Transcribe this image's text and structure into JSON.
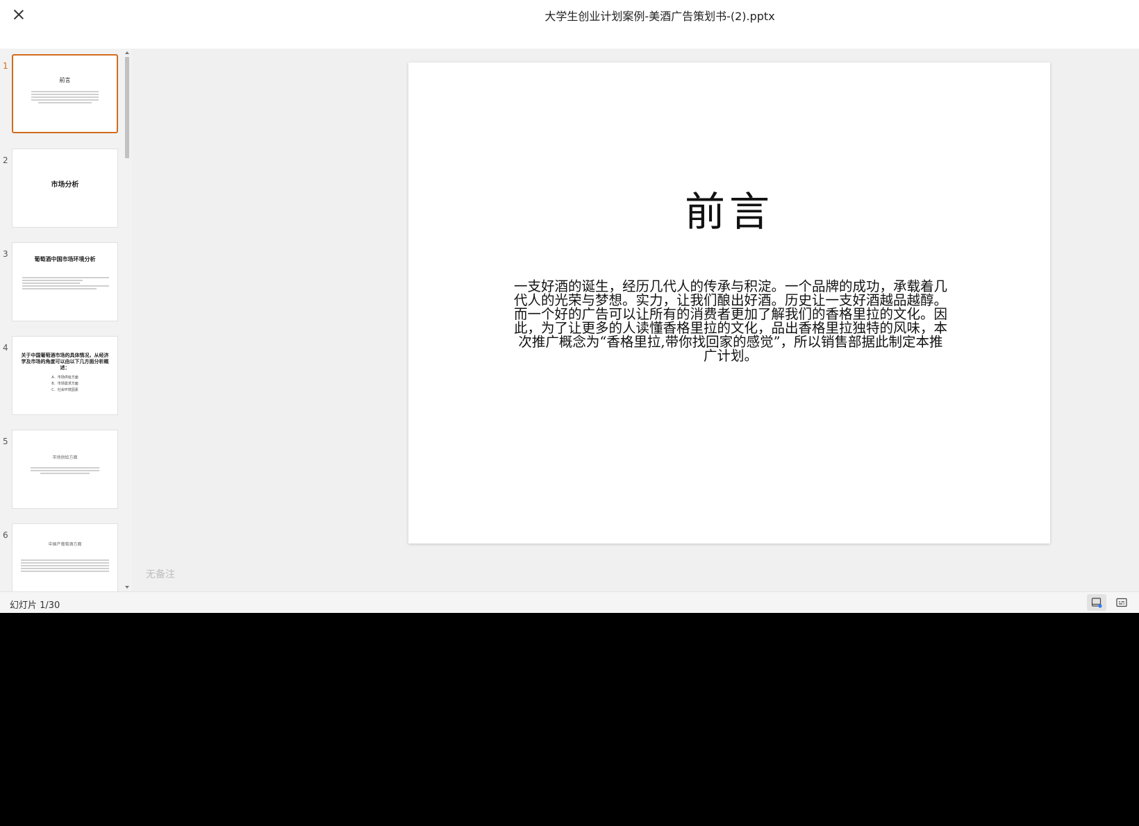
{
  "document": {
    "title": "大学生创业计划案例-美酒广告策划书-(2).pptx"
  },
  "thumbnails": [
    {
      "number": "1",
      "title": "前言"
    },
    {
      "number": "2",
      "title": "市场分析"
    },
    {
      "number": "3",
      "title": "葡萄酒中国市场环境分析"
    },
    {
      "number": "4",
      "title": "关于中国葡萄酒市场的具体情况，从经济学及市场的角度可以由以下几方面分析概述：",
      "items": [
        "A．市场供给方面",
        "B．市场需求方面",
        "C．社会环境因素"
      ]
    },
    {
      "number": "5",
      "title": "市场供给方面"
    },
    {
      "number": "6",
      "title": "中国产葡萄酒方面"
    }
  ],
  "slide": {
    "title": "前言",
    "body": "一支好酒的诞生，经历几代人的传承与积淀。一个品牌的成功，承载着几代人的光荣与梦想。实力，让我们酿出好酒。历史让一支好酒越品越醇。而一个好的广告可以让所有的消费者更加了解我们的香格里拉的文化。因此，为了让更多的人读懂香格里拉的文化，品出香格里拉独特的风味，本次推广概念为“香格里拉,带你找回家的感觉”，所以销售部据此制定本推广计划。"
  },
  "notes": {
    "placeholder": "无备注"
  },
  "status": {
    "slide_counter": "幻灯片 1/30"
  },
  "colors": {
    "accent": "#d26b1e",
    "app_background": "#f0f0f0",
    "outside_background": "#000000"
  },
  "icons": [
    "close-icon",
    "notes-view-icon",
    "subtitles-icon"
  ]
}
